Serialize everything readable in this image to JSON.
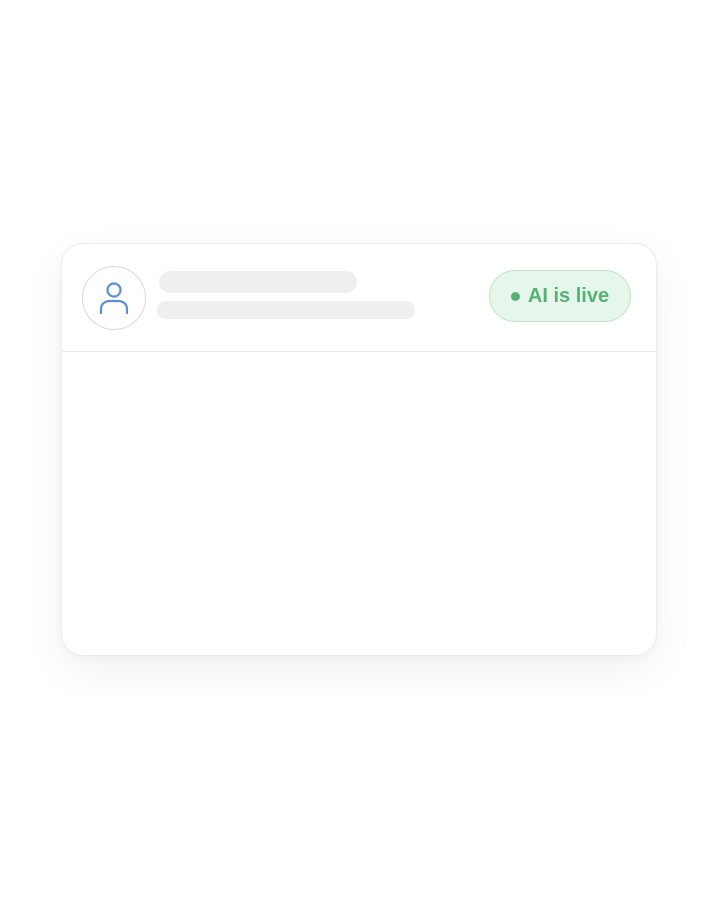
{
  "card": {
    "avatar": {
      "icon": "user-icon",
      "icon_color": "#5b8ed6"
    },
    "status": {
      "label": "AI is live",
      "color": "#55b277",
      "background": "#e6f6ea",
      "border": "#bfe5c9"
    }
  }
}
